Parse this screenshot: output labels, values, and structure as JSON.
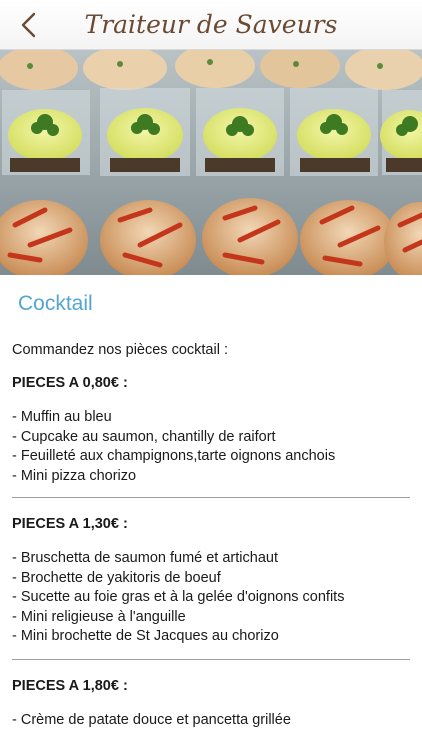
{
  "header": {
    "title": "Traiteur de Saveurs",
    "back_icon": "chevron-left-icon"
  },
  "hero": {
    "description_icon": "cocktail-food-photo"
  },
  "page": {
    "section_title": "Cocktail",
    "intro": "Commandez nos pièces cocktail :"
  },
  "sections": [
    {
      "heading": "PIECES A 0,80€ :",
      "items": [
        "- Muffin au bleu",
        "- Cupcake au saumon, chantilly de raifort",
        "- Feuilleté aux champignons,tarte oignons anchois",
        "- Mini pizza chorizo"
      ]
    },
    {
      "heading": "PIECES A 1,30€ :",
      "items": [
        "- Bruschetta de saumon fumé et artichaut",
        "- Brochette de yakitoris de boeuf",
        "- Sucette au foie gras et à la gelée d'oignons confits",
        "- Mini religieuse à l'anguille",
        "- Mini brochette de St Jacques au chorizo"
      ]
    },
    {
      "heading": "PIECES A 1,80€ :",
      "items": [
        "- Crème de patate douce et pancetta grillée"
      ]
    }
  ],
  "colors": {
    "accent": "#55a6cf",
    "title_brown": "#6b4a33"
  }
}
